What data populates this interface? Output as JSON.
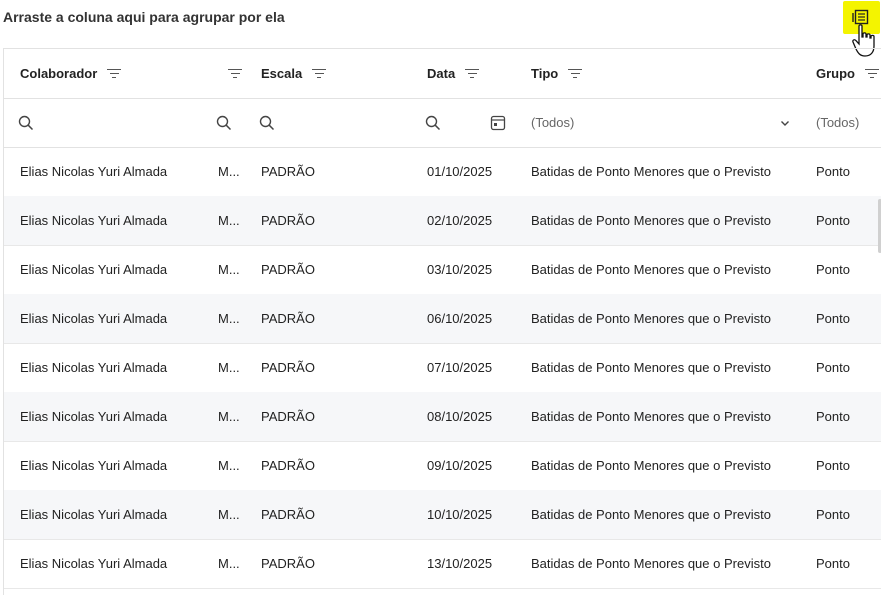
{
  "group_panel": {
    "text": "Arraste a coluna aqui para agrupar por ela"
  },
  "columns": {
    "colaborador": "Colaborador",
    "escala": "Escala",
    "data": "Data",
    "tipo": "Tipo",
    "grupo": "Grupo"
  },
  "filters": {
    "tipo_value": "(Todos)",
    "grupo_value": "(Todos)"
  },
  "rows": [
    {
      "colaborador": "Elias Nicolas Yuri Almada",
      "extra": "M...",
      "escala": "PADRÃO",
      "data": "01/10/2025",
      "tipo": "Batidas de Ponto Menores que o Previsto",
      "grupo": "Ponto"
    },
    {
      "colaborador": "Elias Nicolas Yuri Almada",
      "extra": "M...",
      "escala": "PADRÃO",
      "data": "02/10/2025",
      "tipo": "Batidas de Ponto Menores que o Previsto",
      "grupo": "Ponto"
    },
    {
      "colaborador": "Elias Nicolas Yuri Almada",
      "extra": "M...",
      "escala": "PADRÃO",
      "data": "03/10/2025",
      "tipo": "Batidas de Ponto Menores que o Previsto",
      "grupo": "Ponto"
    },
    {
      "colaborador": "Elias Nicolas Yuri Almada",
      "extra": "M...",
      "escala": "PADRÃO",
      "data": "06/10/2025",
      "tipo": "Batidas de Ponto Menores que o Previsto",
      "grupo": "Ponto"
    },
    {
      "colaborador": "Elias Nicolas Yuri Almada",
      "extra": "M...",
      "escala": "PADRÃO",
      "data": "07/10/2025",
      "tipo": "Batidas de Ponto Menores que o Previsto",
      "grupo": "Ponto"
    },
    {
      "colaborador": "Elias Nicolas Yuri Almada",
      "extra": "M...",
      "escala": "PADRÃO",
      "data": "08/10/2025",
      "tipo": "Batidas de Ponto Menores que o Previsto",
      "grupo": "Ponto"
    },
    {
      "colaborador": "Elias Nicolas Yuri Almada",
      "extra": "M...",
      "escala": "PADRÃO",
      "data": "09/10/2025",
      "tipo": "Batidas de Ponto Menores que o Previsto",
      "grupo": "Ponto"
    },
    {
      "colaborador": "Elias Nicolas Yuri Almada",
      "extra": "M...",
      "escala": "PADRÃO",
      "data": "10/10/2025",
      "tipo": "Batidas de Ponto Menores que o Previsto",
      "grupo": "Ponto"
    },
    {
      "colaborador": "Elias Nicolas Yuri Almada",
      "extra": "M...",
      "escala": "PADRÃO",
      "data": "13/10/2025",
      "tipo": "Batidas de Ponto Menores que o Previsto",
      "grupo": "Ponto"
    }
  ],
  "colors": {
    "highlight": "#f4f400",
    "row_alt": "#f6f7f9",
    "border": "#e2e2e2"
  }
}
